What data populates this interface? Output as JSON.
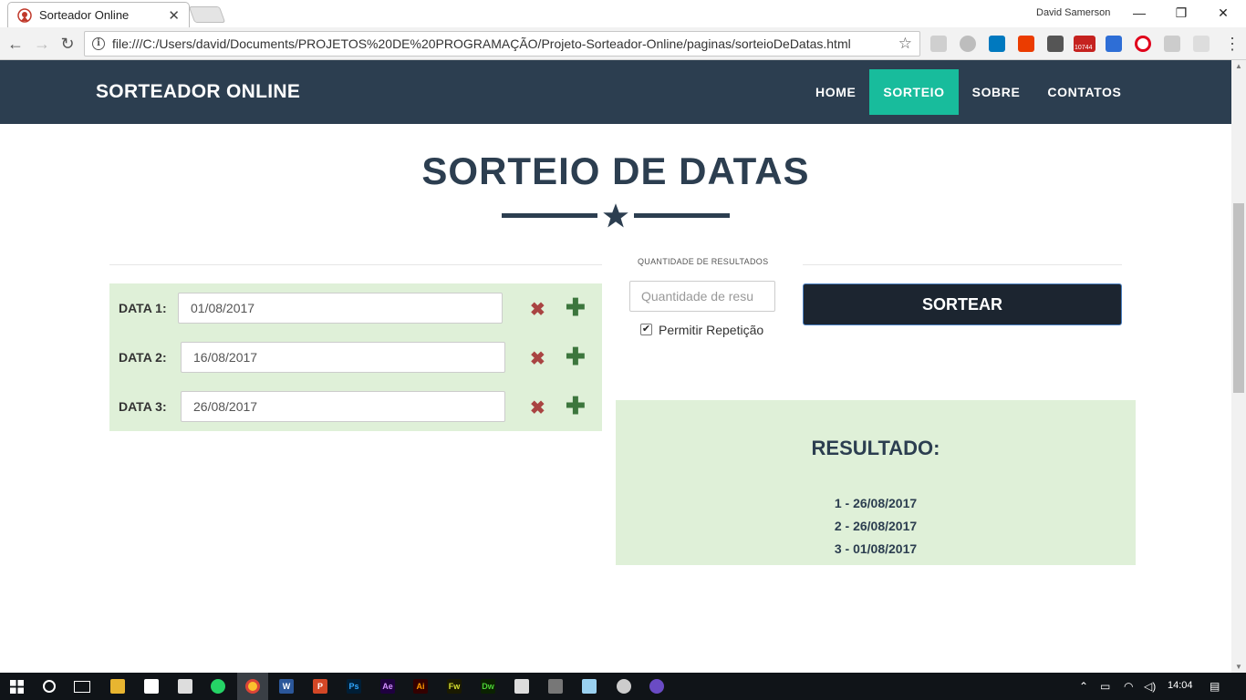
{
  "browser": {
    "tab_title": "Sorteador Online",
    "tab_close": "✕",
    "user_name": "David Samerson",
    "url": "file:///C:/Users/david/Documents/PROJETOS%20DE%20PROGRAMAÇÃO/Projeto-Sorteador-Online/paginas/sorteioDeDatas.html",
    "gmail_count": "10744",
    "win_min": "—",
    "win_restore": "❐",
    "win_close": "✕"
  },
  "nav": {
    "brand": "SORTEADOR ONLINE",
    "links": [
      "HOME",
      "SORTEIO",
      "SOBRE",
      "CONTATOS"
    ]
  },
  "main": {
    "title": "SORTEIO DE DATAS",
    "dates": [
      {
        "label": "DATA 1:",
        "value": "01/08/2017"
      },
      {
        "label": "DATA 2:",
        "value": "16/08/2017"
      },
      {
        "label": "DATA 3:",
        "value": "26/08/2017"
      }
    ],
    "remove_glyph": "✖",
    "add_glyph": "✚",
    "qty_label": "QUANTIDADE DE RESULTADOS",
    "qty_placeholder": "Quantidade de resu",
    "repeat_checked": "✔",
    "repeat_label": "Permitir Repetição",
    "sortear": "SORTEAR"
  },
  "result": {
    "title": "RESULTADO:",
    "items": [
      "1 - 26/08/2017",
      "2 - 26/08/2017",
      "3 - 01/08/2017"
    ]
  },
  "taskbar": {
    "clock": "14:04",
    "apps": [
      "W",
      "P",
      "Ps",
      "Ae",
      "Ai",
      "Fw",
      "Dw"
    ]
  },
  "colors": {
    "navbar": "#2c3e50",
    "accent": "#18bc9c",
    "panel": "#dff0d8",
    "button": "#1c2530"
  }
}
